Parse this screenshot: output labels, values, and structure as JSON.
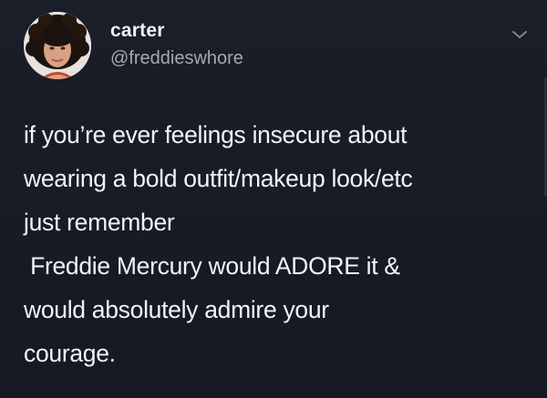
{
  "author": {
    "display_name": "carter",
    "handle": "@freddieswhore",
    "avatar_icon": "profile-photo"
  },
  "more_menu_icon": "chevron-down-icon",
  "tweet": {
    "lines": [
      "if you’re ever feelings insecure about",
      "wearing a bold outfit/makeup look/etc",
      "just remember",
      " Freddie Mercury would ADORE it &",
      "would absolutely admire your",
      "courage."
    ]
  },
  "colors": {
    "background": "#171b25",
    "text": "#f3f3f5",
    "secondary_text": "#a3a8b3"
  }
}
